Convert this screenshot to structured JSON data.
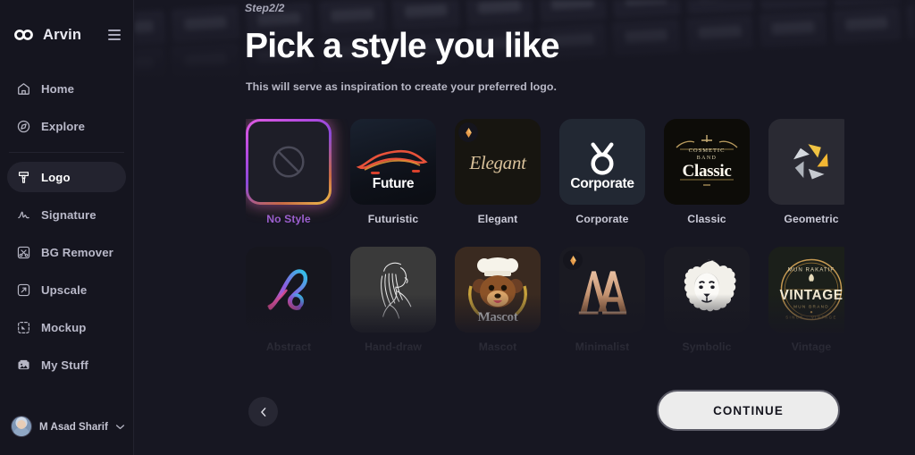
{
  "brand": {
    "name": "Arvin",
    "logo_icon": "infinity-logo-icon",
    "menu_icon": "hamburger-menu-icon"
  },
  "sidebar": {
    "items": [
      {
        "label": "Home",
        "icon": "home-icon",
        "active": false
      },
      {
        "label": "Explore",
        "icon": "compass-icon",
        "active": false
      },
      {
        "label": "Logo",
        "icon": "logo-brush-icon",
        "active": true
      },
      {
        "label": "Signature",
        "icon": "signature-icon",
        "active": false
      },
      {
        "label": "BG Remover",
        "icon": "scissors-icon",
        "active": false
      },
      {
        "label": "Upscale",
        "icon": "upscale-arrow-icon",
        "active": false
      },
      {
        "label": "Mockup",
        "icon": "mockup-icon",
        "active": false
      },
      {
        "label": "My Stuff",
        "icon": "gallery-icon",
        "active": false
      }
    ],
    "user": {
      "name": "M Asad Sharif",
      "avatar_icon": "user-avatar",
      "chevron_icon": "chevron-down-icon"
    }
  },
  "header": {
    "step": "Step2/2",
    "title": "Pick a style you like",
    "subtitle": "This will serve as inspiration to create your preferred logo."
  },
  "styles": [
    {
      "label": "No Style",
      "art": "t-nostyle",
      "art_text": "",
      "selected": true,
      "premium": false,
      "art_icon": "no-style-prohibition-icon"
    },
    {
      "label": "Futuristic",
      "art": "t-futuristic",
      "art_text": "Future",
      "selected": false,
      "premium": false,
      "art_icon": "sports-car-icon"
    },
    {
      "label": "Elegant",
      "art": "t-elegant",
      "art_text": "Elegant",
      "selected": false,
      "premium": true,
      "art_icon": "elegant-script-icon"
    },
    {
      "label": "Corporate",
      "art": "t-corporate",
      "art_text": "Corporate",
      "selected": false,
      "premium": false,
      "art_icon": "corporate-ring-icon"
    },
    {
      "label": "Classic",
      "art": "t-classic",
      "art_text": "Classic",
      "selected": false,
      "premium": false,
      "art_icon": "classic-crest-icon"
    },
    {
      "label": "Geometric",
      "art": "t-geometric",
      "art_text": "",
      "selected": false,
      "premium": false,
      "art_icon": "geometric-petals-icon"
    },
    {
      "label": "Abstract",
      "art": "t-abstract",
      "art_text": "",
      "selected": false,
      "premium": false,
      "art_icon": "abstract-swirl-icon"
    },
    {
      "label": "Hand-draw",
      "art": "t-handdraw",
      "art_text": "",
      "selected": false,
      "premium": false,
      "art_icon": "line-art-woman-icon"
    },
    {
      "label": "Mascot",
      "art": "t-mascot",
      "art_text": "Mascot",
      "selected": false,
      "premium": false,
      "art_icon": "bear-chef-mascot-icon"
    },
    {
      "label": "Minimalist",
      "art": "t-minimalist",
      "art_text": "MA",
      "selected": false,
      "premium": true,
      "art_icon": "monogram-ma-icon"
    },
    {
      "label": "Symbolic",
      "art": "t-symbolic",
      "art_text": "",
      "selected": false,
      "premium": false,
      "art_icon": "lion-head-icon"
    },
    {
      "label": "Vintage",
      "art": "t-vintage",
      "art_text": "VINTAGE",
      "selected": false,
      "premium": false,
      "art_icon": "vintage-badge-icon"
    }
  ],
  "styles_row3": [
    {
      "art": "t-r3a",
      "art_icon": "gold-emblem-icon"
    },
    {
      "art": "t-r3b",
      "art_icon": "red-figure-icon"
    },
    {
      "art": "t-r3c",
      "art_icon": "blue-mark-icon"
    },
    {
      "art": "t-r3d",
      "art_icon": "green-triangle-icon"
    },
    {
      "art": "t-r3e",
      "art_icon": "ornate-crest-icon"
    },
    {
      "art": "t-r3f",
      "art_icon": "white-arc-icon"
    }
  ],
  "footer": {
    "back_icon": "chevron-left-icon",
    "back_label": "",
    "continue_label": "CONTINUE"
  },
  "colors": {
    "background": "#171722",
    "sidebar": "#15151f",
    "selected_label": "#9b5fd0",
    "selection_gradient_start": "#e05ce0",
    "selection_gradient_end": "#f0c24a",
    "continue_button_bg": "#ececec",
    "text_primary": "#ffffff",
    "text_secondary": "#b8b8c6"
  }
}
